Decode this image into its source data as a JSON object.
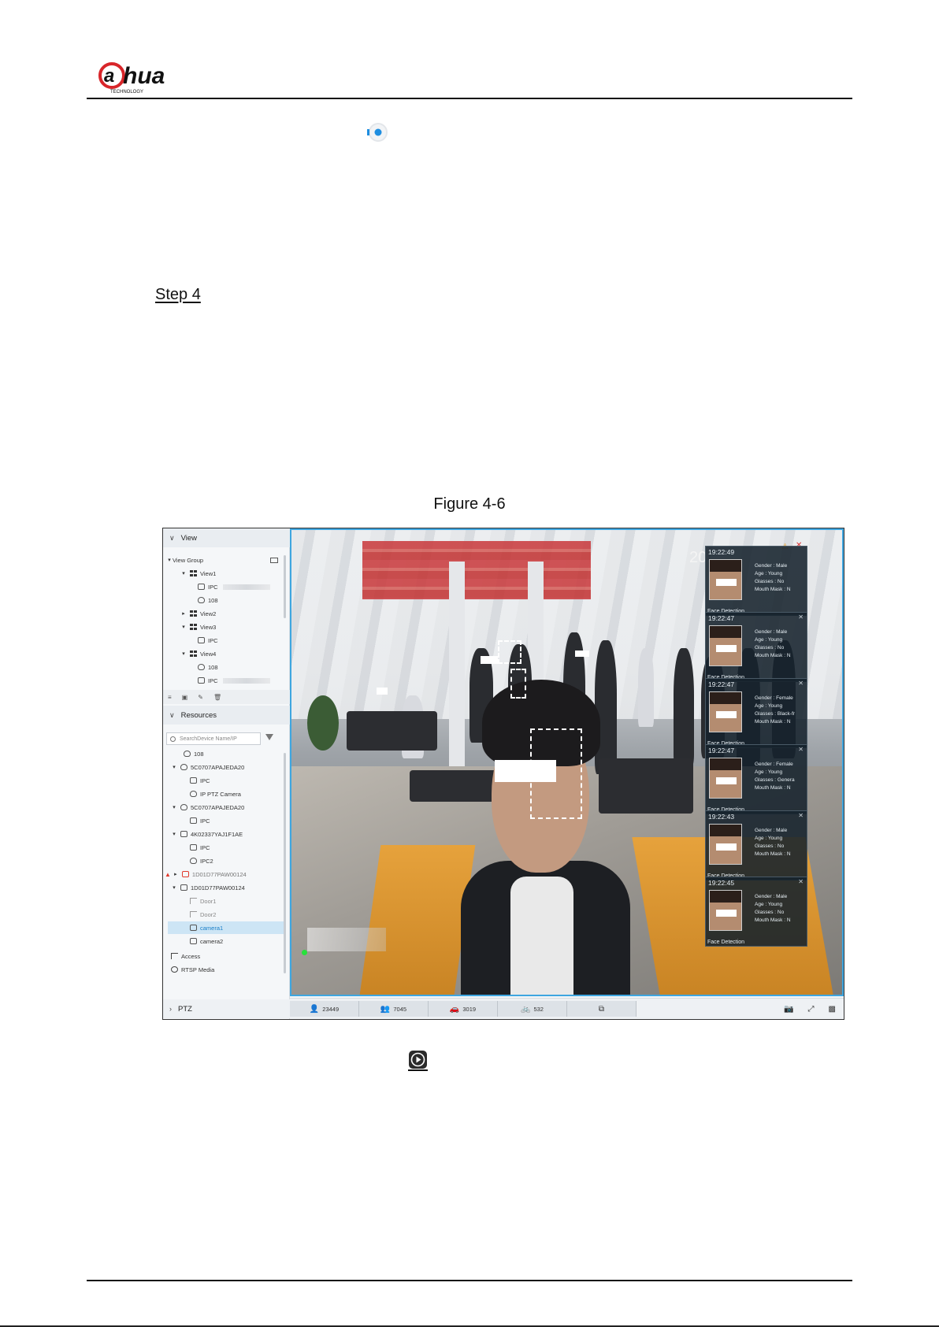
{
  "header": {
    "logo_text": "alhua",
    "logo_sub": "TECHNOLOGY"
  },
  "step": {
    "label": "Step 4"
  },
  "figure": {
    "caption": "Figure 4-6",
    "sidebar": {
      "view_section": "View",
      "view_group": "View Group",
      "views": [
        {
          "label": "View1"
        },
        {
          "label": "IPC"
        },
        {
          "label": "108"
        },
        {
          "label": "View2"
        },
        {
          "label": "View3"
        },
        {
          "label": "IPC"
        },
        {
          "label": "View4"
        },
        {
          "label": "108"
        },
        {
          "label": "IPC"
        }
      ],
      "resources_section": "Resources",
      "search_placeholder": "SearchDevice Name/IP",
      "resources": [
        {
          "label": "108"
        },
        {
          "label": "5C0707APAJEDA20"
        },
        {
          "label": "IPC"
        },
        {
          "label": "IP PTZ Camera"
        },
        {
          "label": "5C0707APAJEDA20"
        },
        {
          "label": "IPC"
        },
        {
          "label": "4K02337YAJ1F1AE"
        },
        {
          "label": "IPC"
        },
        {
          "label": "IPC2"
        },
        {
          "label": "1D01D77PAW00124"
        },
        {
          "label": "1D01D77PAW00124"
        },
        {
          "label": "Door1"
        },
        {
          "label": "Door2"
        },
        {
          "label": "camera1"
        },
        {
          "label": "camera2"
        },
        {
          "label": "Access"
        },
        {
          "label": "RTSP Media"
        }
      ],
      "ptz_section": "PTZ"
    },
    "video": {
      "osd_year": "201",
      "detections": [
        {
          "time": "19:22:49",
          "gender": "Gender : Male",
          "age": "Age : Young",
          "glasses": "Glasses : No",
          "mask": "Mouth Mask : N",
          "label": "Face Detection"
        },
        {
          "time": "19:22:47",
          "gender": "Gender : Male",
          "age": "Age : Young",
          "glasses": "Glasses : No",
          "mask": "Mouth Mask : N",
          "label": "Face Detection"
        },
        {
          "time": "19:22:47",
          "gender": "Gender : Female",
          "age": "Age : Young",
          "glasses": "Glasses : Black-fr",
          "mask": "Mouth Mask : N",
          "label": "Face Detection"
        },
        {
          "time": "19:22:47",
          "gender": "Gender : Female",
          "age": "Age : Young",
          "glasses": "Glasses : Genera",
          "mask": "Mouth Mask : N",
          "label": "Face Detection"
        },
        {
          "time": "19:22:43",
          "gender": "Gender : Male",
          "age": "Age : Young",
          "glasses": "Glasses : No",
          "mask": "Mouth Mask : N",
          "label": "Face Detection"
        },
        {
          "time": "19:22:45",
          "gender": "Gender : Male",
          "age": "Age : Young",
          "glasses": "Glasses : No",
          "mask": "Mouth Mask : N",
          "label": "Face Detection"
        }
      ]
    },
    "stats": {
      "person": "23449",
      "crowd": "7045",
      "car": "3019",
      "bike": "532"
    },
    "colors": {
      "accent": "#3ea6e0",
      "selected": "#cde5f5",
      "alert": "#e0392b"
    }
  }
}
